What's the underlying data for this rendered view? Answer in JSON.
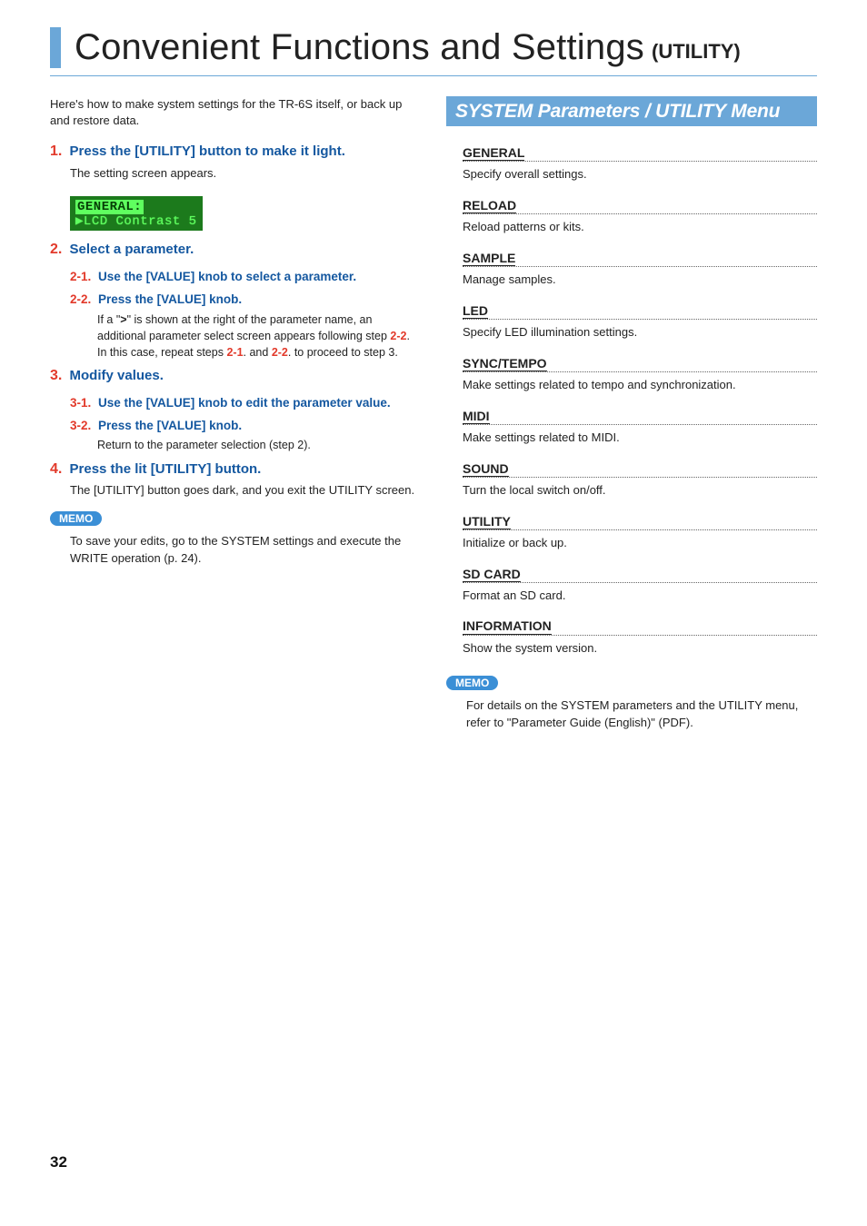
{
  "title": {
    "main": "Convenient Functions and Settings",
    "sub": "(UTILITY)"
  },
  "intro": "Here's how to make system settings for the TR-6S itself, or back up and restore data.",
  "lcd": {
    "line1": "GENERAL:",
    "line2": "▶LCD Contrast  5"
  },
  "steps": [
    {
      "num": "1.",
      "text_pre": "Press the ",
      "text_bracket": "[UTILITY]",
      "text_post": " button to make it light.",
      "body": "The setting screen appears."
    },
    {
      "num": "2.",
      "text_pre": "Select a parameter.",
      "text_bracket": "",
      "text_post": "",
      "body": ""
    },
    {
      "num": "3.",
      "text_pre": "Modify values.",
      "text_bracket": "",
      "text_post": "",
      "body": ""
    },
    {
      "num": "4.",
      "text_pre": "Press the lit ",
      "text_bracket": "[UTILITY]",
      "text_post": " button.",
      "body": "The [UTILITY] button goes dark, and you exit the UTILITY screen."
    }
  ],
  "substeps2": [
    {
      "num": "2-1.",
      "text_pre": "Use the ",
      "text_bracket": "[VALUE]",
      "text_post": " knob to select a parameter.",
      "body": ""
    },
    {
      "num": "2-2.",
      "text_pre": "Press the ",
      "text_bracket": "[VALUE]",
      "text_post": " knob.",
      "body_parts": {
        "a": "If a \"",
        "arrow": ">",
        "b": "\" is shown at the right of the parameter name, an additional parameter select screen appears following step ",
        "s22": "2-2",
        "c": ". In this case, repeat steps ",
        "s21": "2-1",
        "d": ". and ",
        "s22b": "2-2",
        "e": ". to proceed to step 3."
      }
    }
  ],
  "substeps3": [
    {
      "num": "3-1.",
      "text_pre": "Use the ",
      "text_bracket": "[VALUE]",
      "text_post": " knob to edit the parameter value.",
      "body": ""
    },
    {
      "num": "3-2.",
      "text_pre": "Press the ",
      "text_bracket": "[VALUE]",
      "text_post": " knob.",
      "body": "Return to the parameter selection (step 2)."
    }
  ],
  "memo_label": "MEMO",
  "memo_left": "To save your edits, go to the SYSTEM settings and execute the WRITE operation (p. 24).",
  "section_bar": "SYSTEM Parameters / UTILITY Menu",
  "params": [
    {
      "title": "GENERAL",
      "desc": "Specify overall settings."
    },
    {
      "title": "RELOAD",
      "desc": "Reload patterns or kits."
    },
    {
      "title": "SAMPLE",
      "desc": "Manage samples."
    },
    {
      "title": "LED",
      "desc": "Specify LED illumination settings."
    },
    {
      "title": "SYNC/TEMPO",
      "desc": "Make settings related to tempo and synchronization."
    },
    {
      "title": "MIDI",
      "desc": "Make settings related to MIDI."
    },
    {
      "title": "SOUND",
      "desc": "Turn the local switch on/off."
    },
    {
      "title": "UTILITY",
      "desc": "Initialize or back up."
    },
    {
      "title": "SD CARD",
      "desc": "Format an SD card."
    },
    {
      "title": "INFORMATION",
      "desc": "Show the system version."
    }
  ],
  "memo_right": "For details on the SYSTEM parameters and the UTILITY menu, refer to \"Parameter Guide (English)\" (PDF).",
  "page_number": "32"
}
